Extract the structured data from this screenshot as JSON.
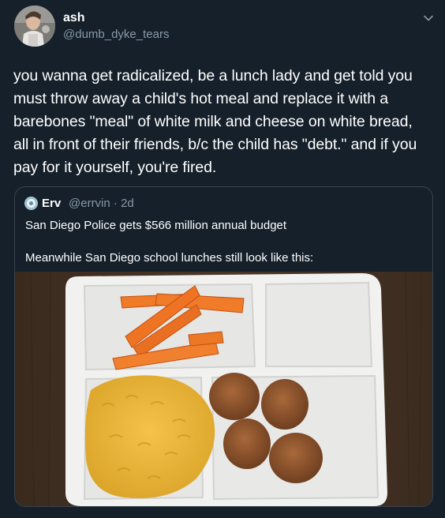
{
  "author": {
    "name": "ash",
    "handle": "@dumb_dyke_tears"
  },
  "tweet": {
    "text": "you wanna get radicalized, be a lunch lady and get told you must throw away a child's hot meal and replace it with a barebones \"meal\" of white milk and cheese on white bread, all in front of their friends, b/c the child has \"debt.\" and if you pay for it yourself, you're fired."
  },
  "quoted_tweet": {
    "name": "Erv",
    "handle_time": "@errvin · 2d",
    "line1": "San Diego Police gets $566 million annual budget",
    "line2": "Meanwhile San Diego school lunches still look like this:"
  },
  "icons": {
    "caret": "chevron-down-icon"
  },
  "colors": {
    "background": "#15202b",
    "text_primary": "#ffffff",
    "text_secondary": "#8899a6",
    "border": "#38444d"
  }
}
